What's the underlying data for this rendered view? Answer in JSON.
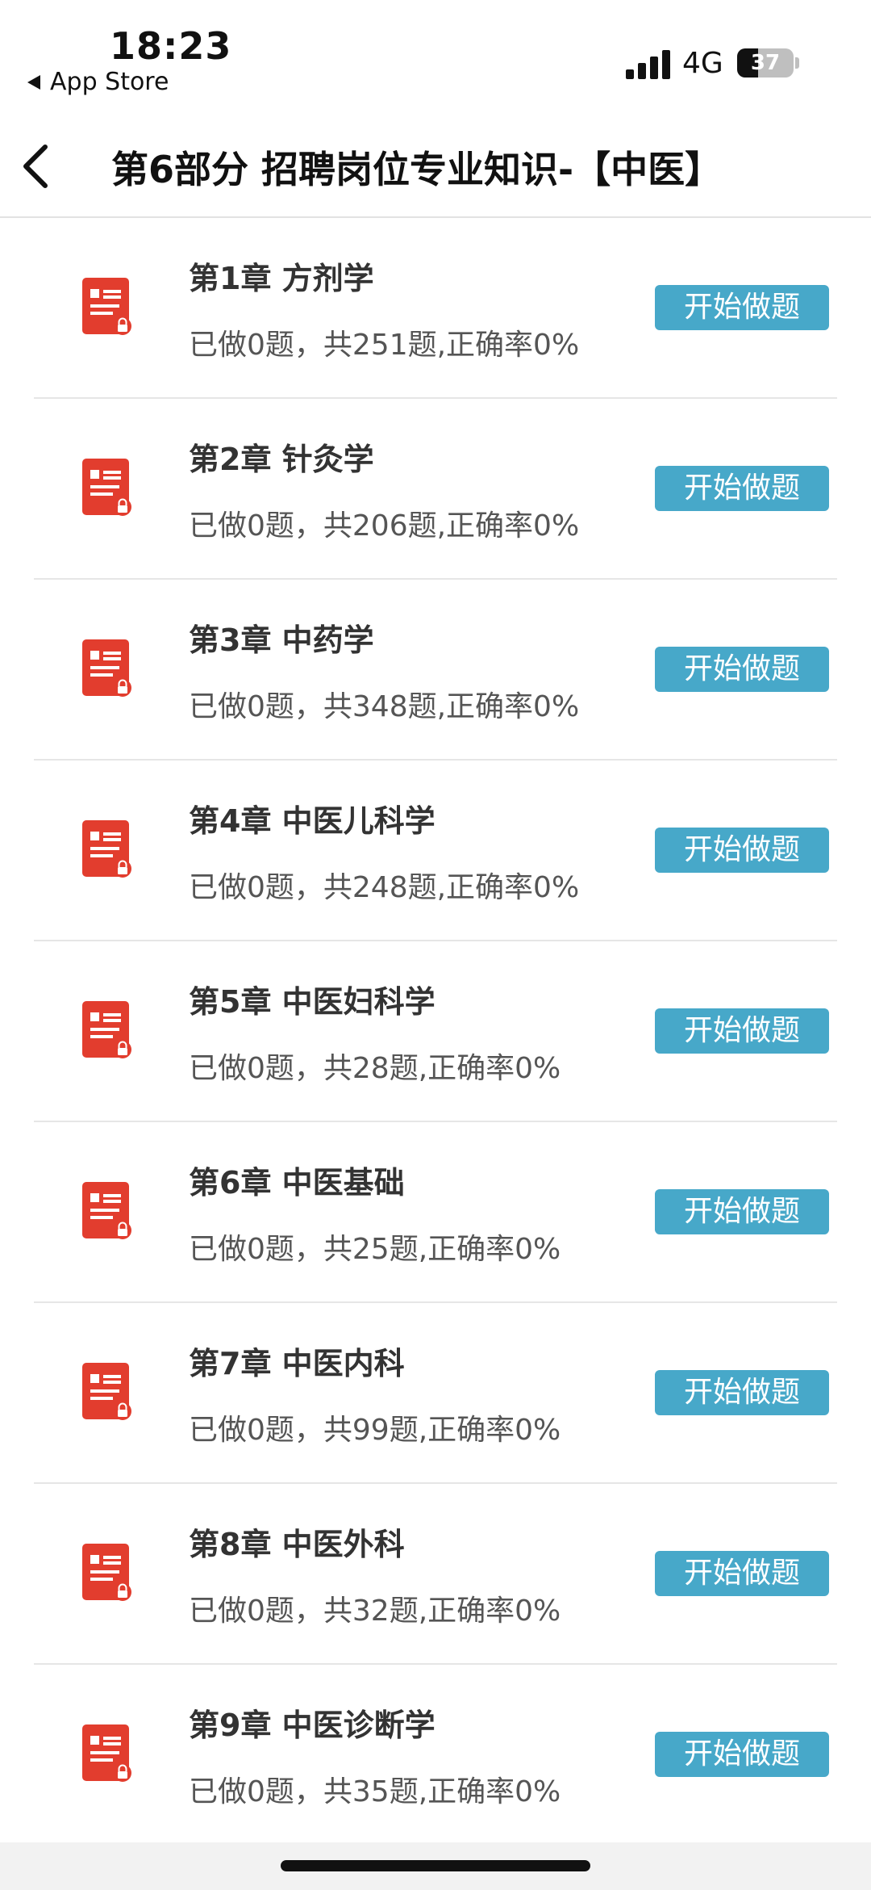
{
  "status_bar": {
    "time": "18:23",
    "back_app": "App Store",
    "network": "4G",
    "battery": "37",
    "battery_level_pct": 37
  },
  "header": {
    "title": "第6部分 招聘岗位专业知识-【中医】"
  },
  "chapters": [
    {
      "title": "第1章 方剂学",
      "stats": "已做0题，共251题,正确率0%",
      "button": "开始做题"
    },
    {
      "title": "第2章 针灸学",
      "stats": "已做0题，共206题,正确率0%",
      "button": "开始做题"
    },
    {
      "title": "第3章 中药学",
      "stats": "已做0题，共348题,正确率0%",
      "button": "开始做题"
    },
    {
      "title": "第4章 中医儿科学",
      "stats": "已做0题，共248题,正确率0%",
      "button": "开始做题"
    },
    {
      "title": "第5章 中医妇科学",
      "stats": "已做0题，共28题,正确率0%",
      "button": "开始做题"
    },
    {
      "title": "第6章 中医基础",
      "stats": "已做0题，共25题,正确率0%",
      "button": "开始做题"
    },
    {
      "title": "第7章 中医内科",
      "stats": "已做0题，共99题,正确率0%",
      "button": "开始做题"
    },
    {
      "title": "第8章 中医外科",
      "stats": "已做0题，共32题,正确率0%",
      "button": "开始做题"
    },
    {
      "title": "第9章 中医诊断学",
      "stats": "已做0题，共35题,正确率0%",
      "button": "开始做题"
    }
  ],
  "colors": {
    "accent_button": "#47a8c9",
    "icon_red": "#e23d2e"
  },
  "icons": {
    "back": "chevron-left-icon",
    "chapter": "locked-document-icon"
  }
}
